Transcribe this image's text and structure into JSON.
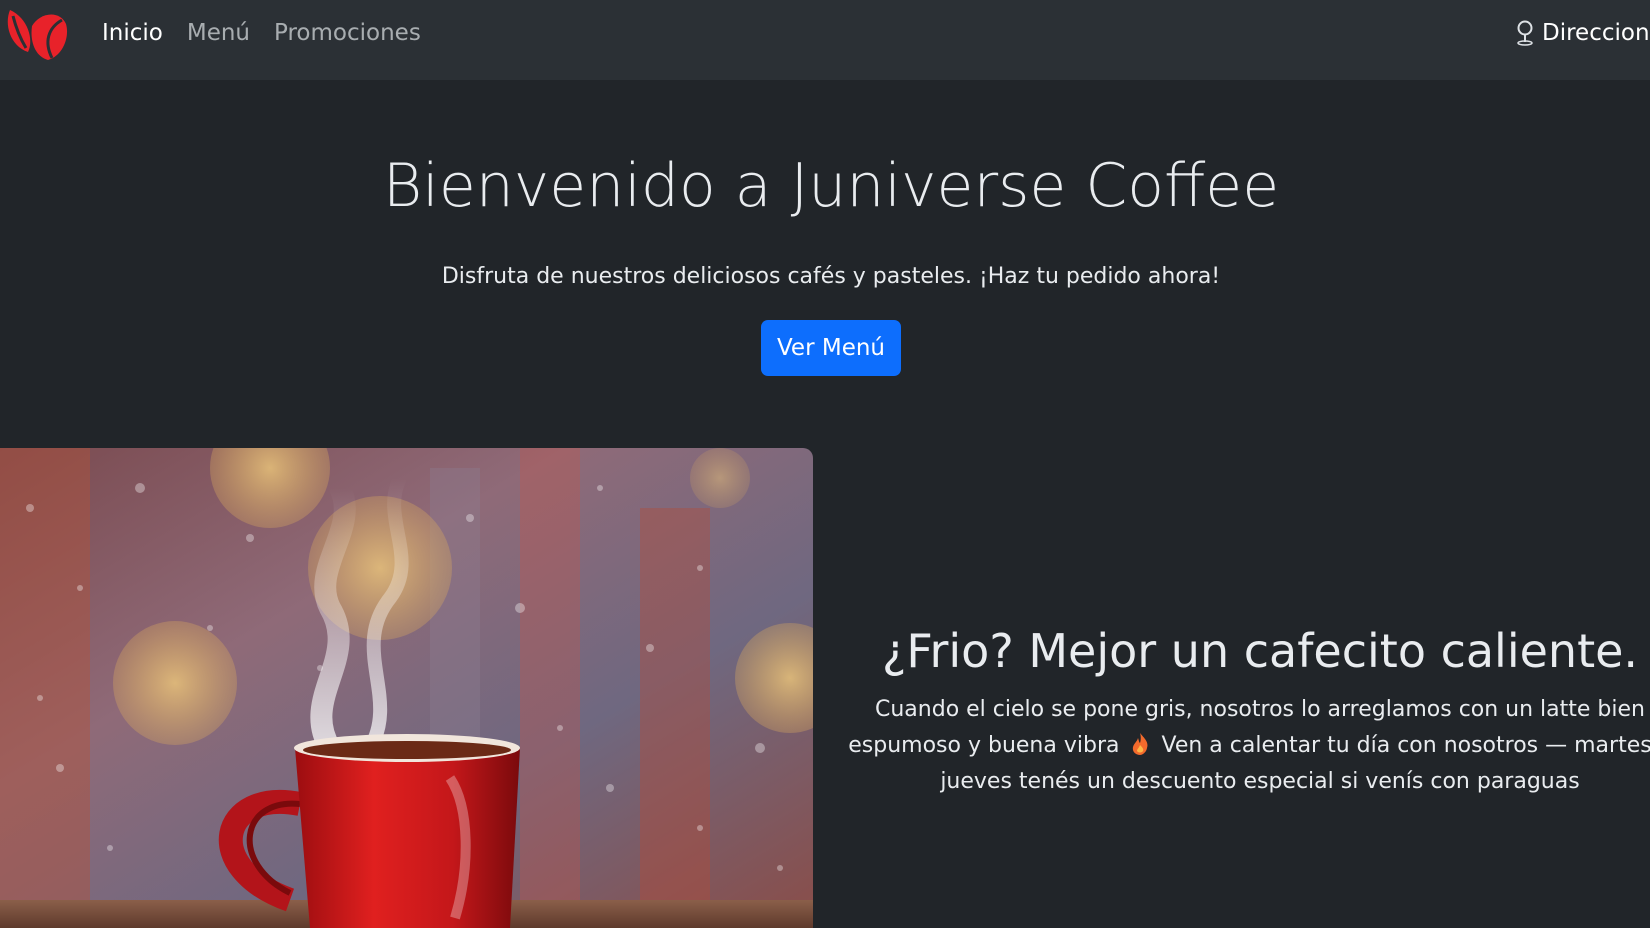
{
  "navbar": {
    "logo_icon": "coffee-beans-logo-icon",
    "links": [
      {
        "label": "Inicio",
        "active": true
      },
      {
        "label": "Menú",
        "active": false
      },
      {
        "label": "Promociones",
        "active": false
      }
    ],
    "right_link": {
      "label": "Direcciones",
      "icon": "location-pin-icon"
    }
  },
  "hero": {
    "title": "Bienvenido a Juniverse Coffee",
    "subtitle": "Disfruta de nuestros deliciosos cafés y pasteles. ¡Haz tu pedido ahora!",
    "cta_label": "Ver Menú"
  },
  "promo": {
    "image": "red-coffee-cup-rainy-window-image",
    "title": "¿Frio? Mejor un cafecito caliente.",
    "text_before_icon": "Cuando el cielo se pone gris, nosotros lo arreglamos con un latte bien espumoso y buena vibra",
    "icon": "fire-icon",
    "text_after_icon": "Ven a calentar tu día con nosotros — martes y jueves tenés un descuento especial si venís con paraguas"
  },
  "colors": {
    "background": "#212529",
    "navbar": "#2b3035",
    "primary": "#0d6efd",
    "logo": "#e8222a"
  }
}
